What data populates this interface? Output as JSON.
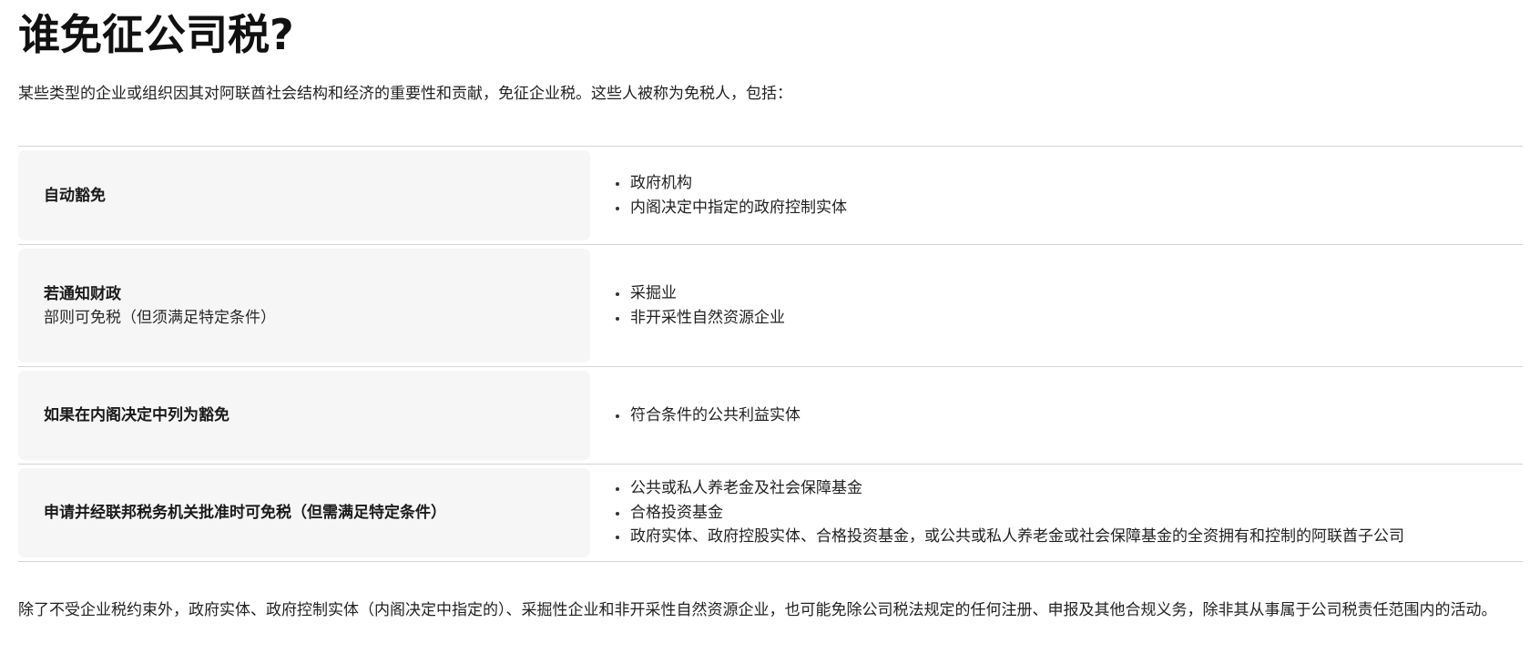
{
  "page": {
    "title": "谁免征公司税?",
    "intro": "某些类型的企业或组织因其对阿联酋社会结构和经济的重要性和贡献，免征企业税。这些人被称为免税人，包括：",
    "footnote": "除了不受企业税约束外，政府实体、政府控制实体（内阁决定中指定的）、采掘性企业和非开采性自然资源企业，也可能免除公司税法规定的任何注册、申报及其他合规义务，除非其从事属于公司税责任范围内的活动。"
  },
  "table": {
    "rows": [
      {
        "left_title": "自动豁免",
        "left_sub": "",
        "items": [
          "政府机构",
          "内阁决定中指定的政府控制实体"
        ]
      },
      {
        "left_title": "若通知财政",
        "left_sub": "部则可免税（但须满足特定条件）",
        "items": [
          "采掘业",
          "非开采性自然资源企业"
        ]
      },
      {
        "left_title": "如果在内阁决定中列为豁免",
        "left_sub": "",
        "items": [
          "符合条件的公共利益实体"
        ]
      },
      {
        "left_title": "申请并经联邦税务机关批准时可免税（但需满足特定条件）",
        "left_sub": "",
        "items": [
          "公共或私人养老金及社会保障基金",
          "合格投资基金",
          "政府实体、政府控股实体、合格投资基金，或公共或私人养老金或社会保障基金的全资拥有和控制的阿联酋子公司"
        ]
      }
    ]
  },
  "colors": {
    "left_cell_background": "#f6f6f6",
    "divider": "#d4d4d4",
    "text": "#1a1a1a"
  }
}
